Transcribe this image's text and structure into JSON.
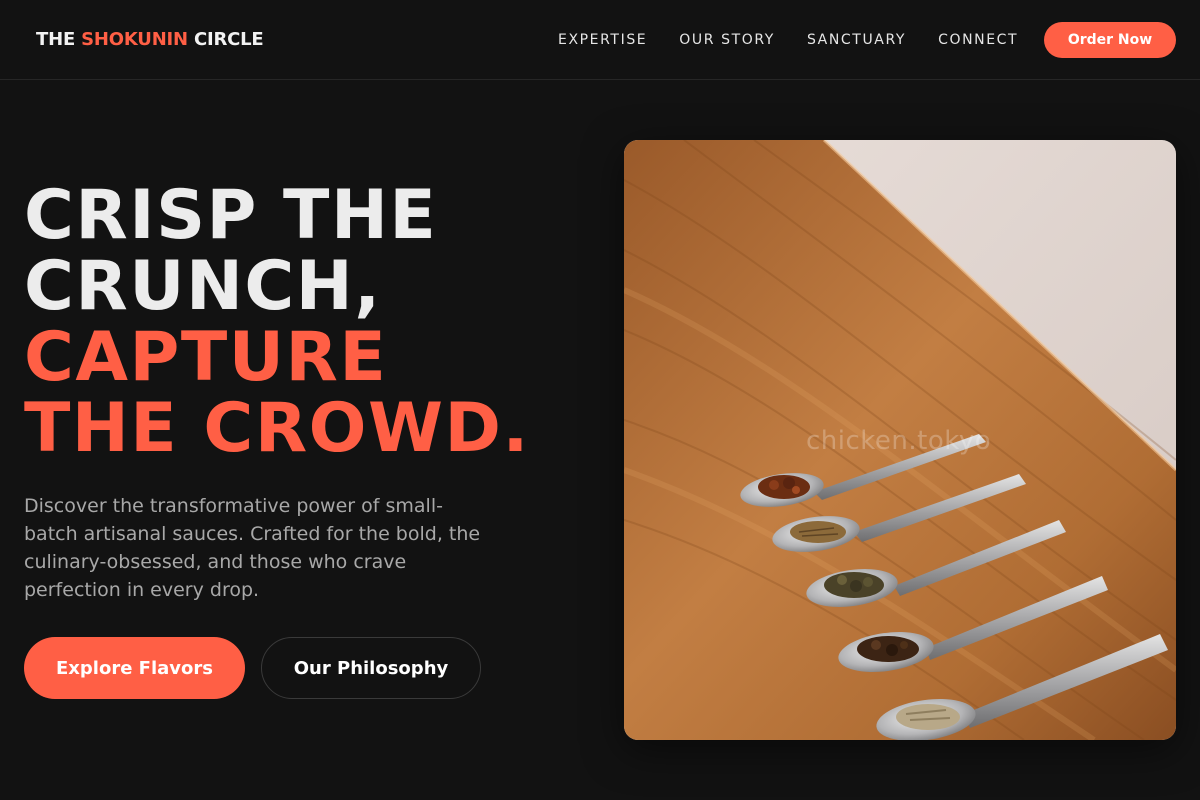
{
  "header": {
    "logo_part1": "THE ",
    "logo_accent": "SHOKUNIN",
    "logo_part2": " CIRCLE",
    "nav": [
      {
        "label": "EXPERTISE"
      },
      {
        "label": "OUR STORY"
      },
      {
        "label": "SANCTUARY"
      },
      {
        "label": "CONNECT"
      }
    ],
    "cta_label": "Order Now"
  },
  "hero": {
    "headline_line1": "CRISP THE",
    "headline_line2": "CRUNCH,",
    "headline_line3": "CAPTURE",
    "headline_line4": "THE CROWD.",
    "description": "Discover the transformative power of small-batch artisanal sauces. Crafted for the bold, the culinary-obsessed, and those who crave perfection in every drop.",
    "primary_button": "Explore Flavors",
    "secondary_button": "Our Philosophy"
  },
  "photo": {
    "watermark": "chicken.tokyo",
    "subject": "five-spoons-of-spices-on-wooden-table"
  },
  "colors": {
    "accent": "#ff5f45",
    "background": "#121212",
    "text": "#ececec",
    "muted_text": "#a8a8a8"
  }
}
